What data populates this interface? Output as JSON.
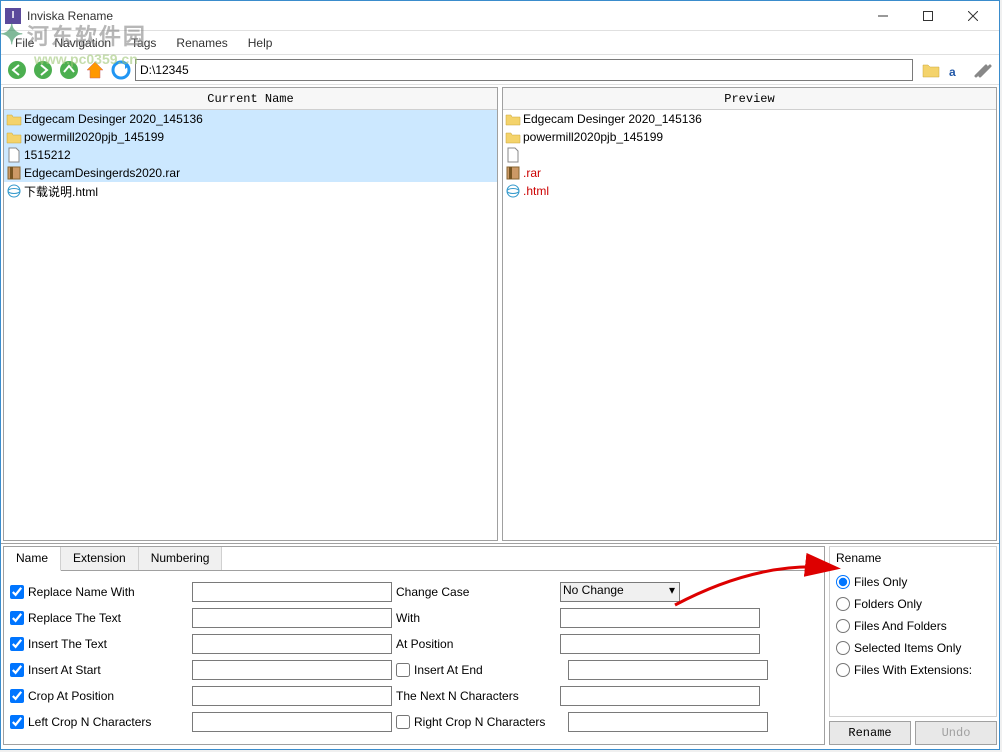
{
  "window": {
    "title": "Inviska Rename"
  },
  "menubar": [
    "File",
    "Navigation",
    "Tags",
    "Renames",
    "Help"
  ],
  "toolbar": {
    "path": "D:\\12345"
  },
  "panels": {
    "current": {
      "header": "Current Name",
      "files": [
        {
          "name": "Edgecam Desinger 2020_145136",
          "type": "folder"
        },
        {
          "name": "powermill2020pjb_145199",
          "type": "folder"
        },
        {
          "name": "1515212",
          "type": "file"
        },
        {
          "name": "EdgecamDesingerds2020.rar",
          "type": "rar"
        },
        {
          "name": "下载说明.html",
          "type": "html"
        }
      ]
    },
    "preview": {
      "header": "Preview",
      "files": [
        {
          "name": "Edgecam Desinger 2020_145136",
          "type": "folder",
          "changed": false
        },
        {
          "name": "powermill2020pjb_145199",
          "type": "folder",
          "changed": false
        },
        {
          "name": "",
          "type": "file",
          "changed": false
        },
        {
          "name": ".rar",
          "type": "rar",
          "changed": true
        },
        {
          "name": ".html",
          "type": "html",
          "changed": true
        }
      ]
    }
  },
  "tabs": {
    "items": [
      "Name",
      "Extension",
      "Numbering"
    ],
    "active": 0
  },
  "form": {
    "rows": [
      {
        "chk": true,
        "label": "Replace Name With",
        "label2": "Change Case",
        "select": "No Change"
      },
      {
        "chk": true,
        "label": "Replace The Text",
        "label2": "With"
      },
      {
        "chk": true,
        "label": "Insert The Text",
        "label2": "At Position"
      },
      {
        "chk": true,
        "label": "Insert At Start",
        "chk2": false,
        "label2": "Insert At End"
      },
      {
        "chk": true,
        "label": "Crop At Position",
        "label2": "The Next N Characters"
      },
      {
        "chk": true,
        "label": "Left Crop N Characters",
        "chk2": false,
        "label2": "Right Crop N Characters"
      }
    ]
  },
  "rename": {
    "title": "Rename",
    "options": [
      {
        "label": "Files Only",
        "checked": true
      },
      {
        "label": "Folders Only",
        "checked": false
      },
      {
        "label": "Files And Folders",
        "checked": false
      },
      {
        "label": "Selected Items Only",
        "checked": false
      },
      {
        "label": "Files With Extensions:",
        "checked": false
      }
    ],
    "buttons": {
      "rename": "Rename",
      "undo": "Undo"
    }
  },
  "watermark": {
    "text": "河东软件园",
    "url": "www.pc0359.cn"
  }
}
